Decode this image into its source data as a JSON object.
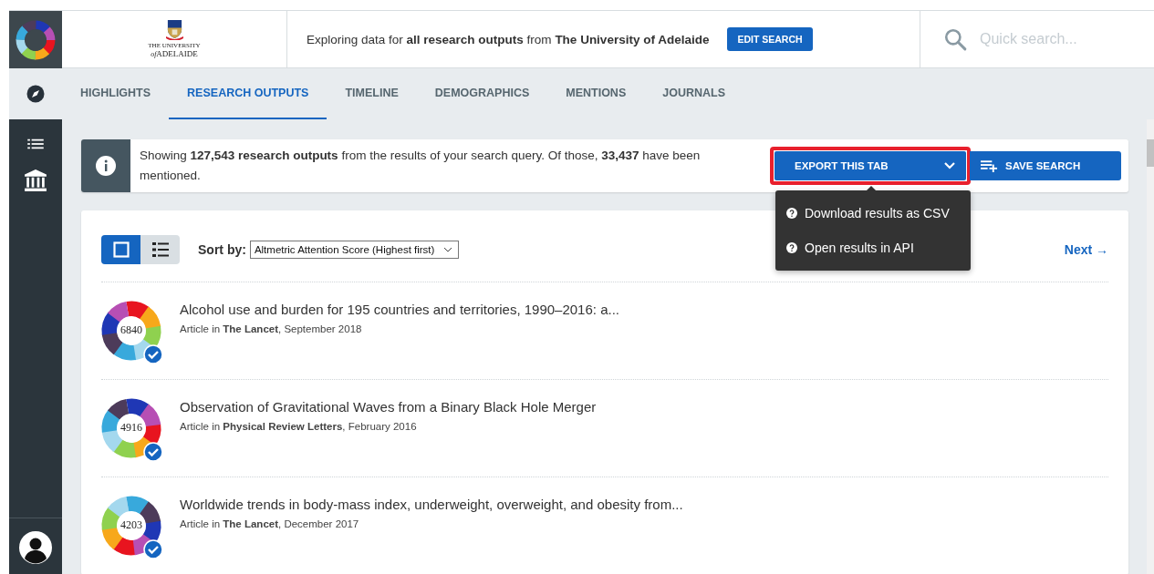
{
  "header": {
    "university_logo": {
      "line1": "THE UNIVERSITY",
      "prefix": "of",
      "line2": "ADELAIDE"
    },
    "summary": "Exploring data for **all research outputs** from **The University of Adelaide**",
    "edit_button": "EDIT SEARCH",
    "search": {
      "placeholder": "Quick search..."
    }
  },
  "tabs": [
    {
      "label": "HIGHLIGHTS",
      "selected": false
    },
    {
      "label": "RESEARCH OUTPUTS",
      "selected": true
    },
    {
      "label": "TIMELINE",
      "selected": false
    },
    {
      "label": "DEMOGRAPHICS",
      "selected": false
    },
    {
      "label": "MENTIONS",
      "selected": false
    },
    {
      "label": "JOURNALS",
      "selected": false
    }
  ],
  "info": {
    "text": "Showing **127,543 research outputs** from the results of your search query. Of those, **33,437** have been mentioned.",
    "export_button": {
      "label": "EXPORT THIS TAB",
      "expanded": true,
      "highlighted": true
    },
    "save_button": "SAVE SEARCH",
    "export_menu": [
      "Download results as CSV",
      "Open results in API"
    ]
  },
  "results": {
    "views": [
      {
        "kind": "grid",
        "selected": true
      },
      {
        "kind": "list",
        "selected": false
      }
    ],
    "sort_label": "Sort by:",
    "sort_value": "Altmetric Attention Score (Highest first)",
    "next_link": "Next →",
    "items": [
      {
        "score": "6840",
        "title": "Alcohol use and burden for 195 countries and territories, 1990–2016: a...",
        "meta": "Article in **The Lancet**, September 2018"
      },
      {
        "score": "4916",
        "title": "Observation of Gravitational Waves from a Binary Black Hole Merger",
        "meta": "Article in **Physical Review Letters**, February 2016"
      },
      {
        "score": "4203",
        "title": "Worldwide trends in body-mass index, underweight, overweight, and obesity from...",
        "meta": "Article in **The Lancet**, December 2017"
      }
    ]
  }
}
